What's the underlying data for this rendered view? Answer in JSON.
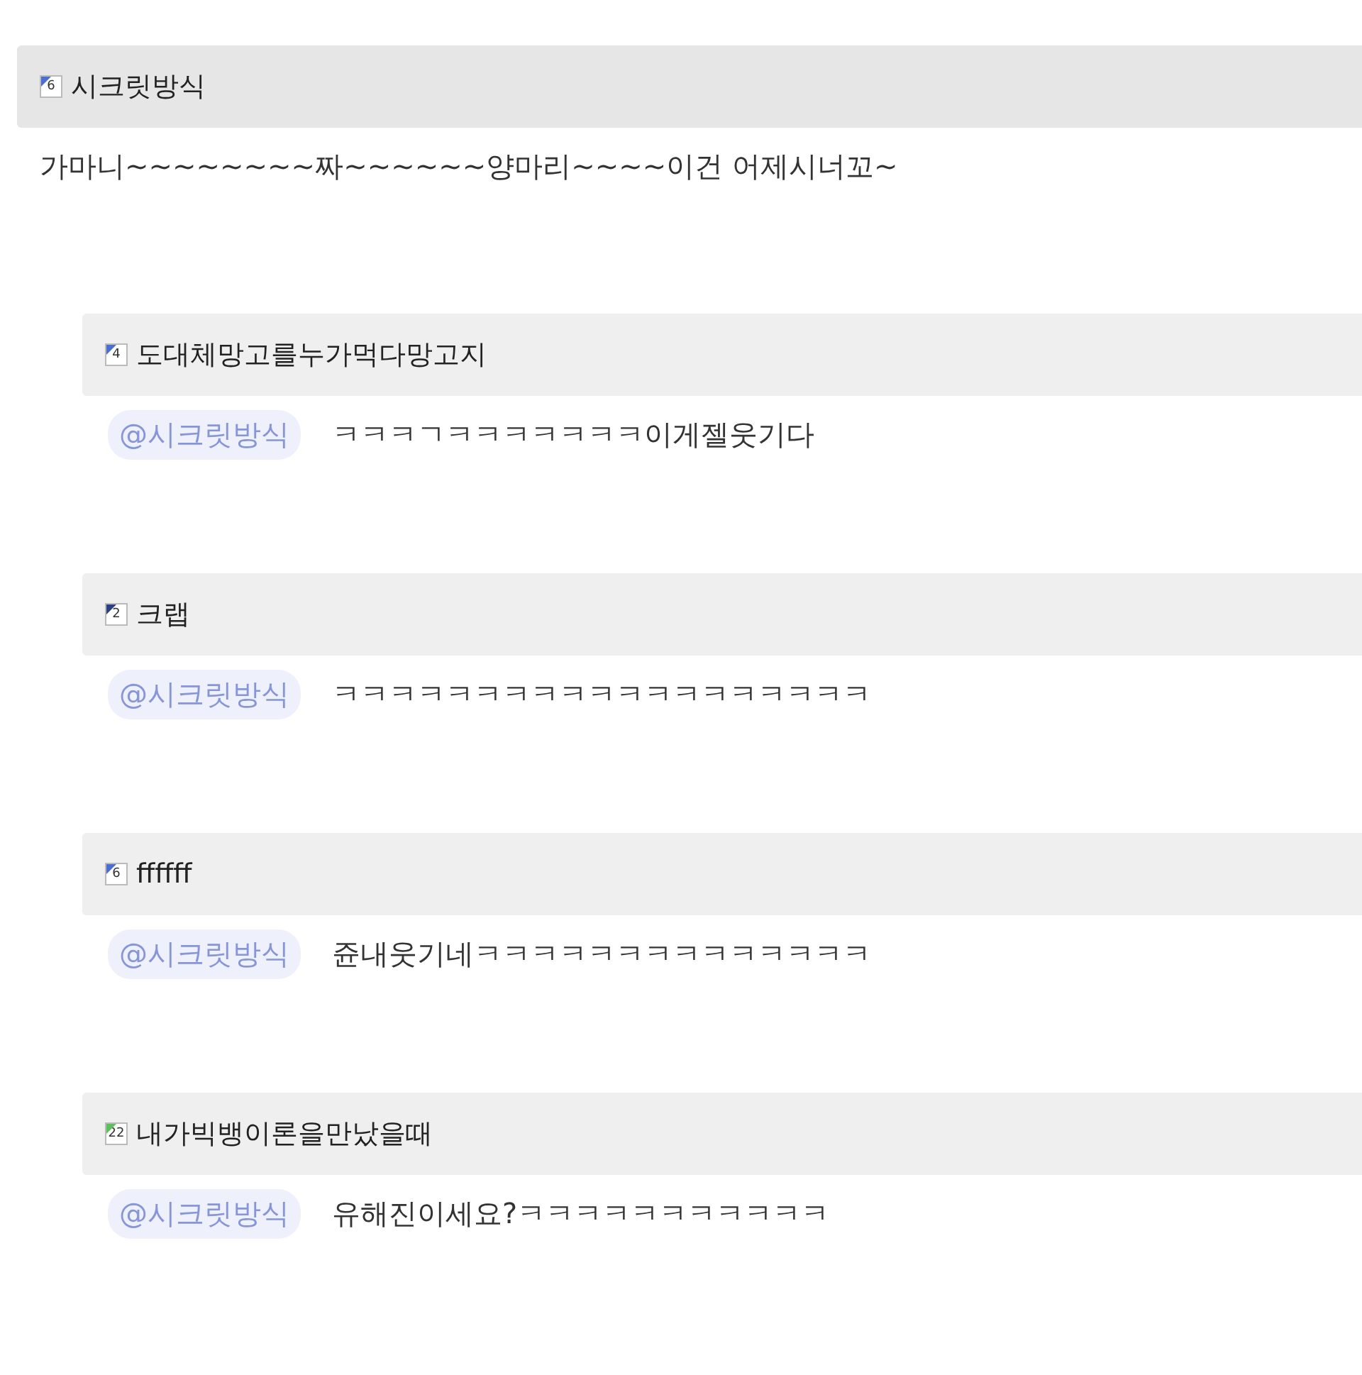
{
  "post": {
    "author": {
      "level": "6",
      "color": "#4a6fd0",
      "name": "시크릿방식"
    },
    "text": "가마니~~~~~~~~짜~~~~~~양마리~~~~이건 어제시너꼬~"
  },
  "replies": [
    {
      "author": {
        "level": "4",
        "color": "#4a6fd0",
        "name": "도대체망고를누가먹다망고지"
      },
      "mention": "@시크릿방식",
      "text": "ㅋㅋㅋㄱㅋㅋㅋㅋㅋㅋㅋ이게젤웃기다"
    },
    {
      "author": {
        "level": "2",
        "color": "#2c3f80",
        "name": "크랩"
      },
      "mention": "@시크릿방식",
      "text": "ㅋㅋㅋㅋㅋㅋㅋㅋㅋㅋㅋㅋㅋㅋㅋㅋㅋㅋㅋ"
    },
    {
      "author": {
        "level": "6",
        "color": "#4a6fd0",
        "name": "ffffff"
      },
      "mention": "@시크릿방식",
      "text": "쥰내웃기네ㅋㅋㅋㅋㅋㅋㅋㅋㅋㅋㅋㅋㅋㅋ"
    },
    {
      "author": {
        "level": "22",
        "color": "#5cc05c",
        "name": "내가빅뱅이론을만났을때"
      },
      "mention": "@시크릿방식",
      "text": "유해진이세요?ㅋㅋㅋㅋㅋㅋㅋㅋㅋㅋㅋ"
    }
  ]
}
